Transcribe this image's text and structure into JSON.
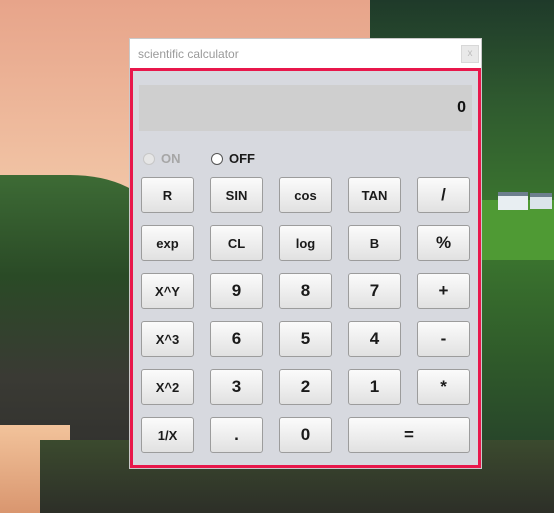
{
  "window": {
    "title": "scientific calculator",
    "close_label": "x"
  },
  "display": {
    "value": "0"
  },
  "power": {
    "on_label": "ON",
    "off_label": "OFF",
    "selected": "OFF"
  },
  "keys": {
    "r": "R",
    "sin": "SIN",
    "cos": "cos",
    "tan": "TAN",
    "divide": "/",
    "exp": "exp",
    "cl": "CL",
    "log": "log",
    "b": "B",
    "percent": "%",
    "x_pow_y": "X^Y",
    "nine": "9",
    "eight": "8",
    "seven": "7",
    "plus": "+",
    "x_cube": "X^3",
    "six": "6",
    "five": "5",
    "four": "4",
    "minus": "-",
    "x_square": "X^2",
    "three": "3",
    "two": "2",
    "one": "1",
    "multiply": "*",
    "reciprocal": "1/X",
    "dot": ".",
    "zero": "0",
    "equals": "="
  }
}
